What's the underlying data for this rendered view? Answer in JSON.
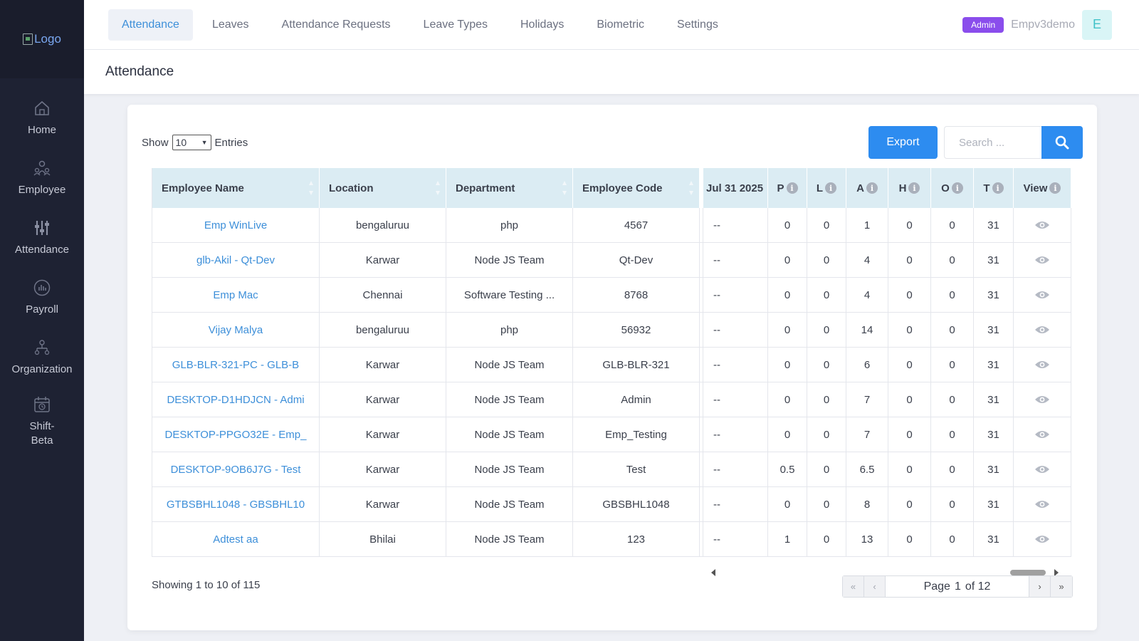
{
  "sidebar": {
    "logo_alt": "Logo",
    "items": [
      {
        "label": "Home",
        "icon": "home-icon"
      },
      {
        "label": "Employee",
        "icon": "employee-icon"
      },
      {
        "label": "Attendance",
        "icon": "attendance-icon"
      },
      {
        "label": "Payroll",
        "icon": "payroll-icon"
      },
      {
        "label": "Organization",
        "icon": "organization-icon"
      },
      {
        "label": "Shift-Beta",
        "icon": "shift-icon"
      }
    ]
  },
  "topbar": {
    "tabs": [
      "Attendance",
      "Leaves",
      "Attendance Requests",
      "Leave Types",
      "Holidays",
      "Biometric",
      "Settings"
    ],
    "active_tab": "Attendance",
    "role_badge": "Admin",
    "username": "Empv3demo",
    "avatar_letter": "E"
  },
  "page": {
    "title": "Attendance"
  },
  "controls": {
    "show_label": "Show",
    "entries_value": "10",
    "entries_label": "Entries",
    "export_label": "Export",
    "search_placeholder": "Search ..."
  },
  "table": {
    "headers": {
      "name": "Employee Name",
      "location": "Location",
      "department": "Department",
      "code": "Employee Code",
      "date": "Jul 31 2025",
      "p": "P",
      "l": "L",
      "a": "A",
      "h": "H",
      "o": "O",
      "t": "T",
      "view": "View"
    },
    "rows": [
      {
        "name": "Emp WinLive",
        "location": "bengaluruu",
        "department": "php",
        "code": "4567",
        "date": "--",
        "p": "0",
        "l": "0",
        "a": "1",
        "h": "0",
        "o": "0",
        "t": "31"
      },
      {
        "name": "glb-Akil - Qt-Dev",
        "location": "Karwar",
        "department": "Node JS Team",
        "code": "Qt-Dev",
        "date": "--",
        "p": "0",
        "l": "0",
        "a": "4",
        "h": "0",
        "o": "0",
        "t": "31"
      },
      {
        "name": "Emp Mac",
        "location": "Chennai",
        "department": "Software Testing ...",
        "code": "8768",
        "date": "--",
        "p": "0",
        "l": "0",
        "a": "4",
        "h": "0",
        "o": "0",
        "t": "31"
      },
      {
        "name": "Vijay Malya",
        "location": "bengaluruu",
        "department": "php",
        "code": "56932",
        "date": "--",
        "p": "0",
        "l": "0",
        "a": "14",
        "h": "0",
        "o": "0",
        "t": "31"
      },
      {
        "name": "GLB-BLR-321-PC - GLB-B",
        "location": "Karwar",
        "department": "Node JS Team",
        "code": "GLB-BLR-321",
        "date": "--",
        "p": "0",
        "l": "0",
        "a": "6",
        "h": "0",
        "o": "0",
        "t": "31"
      },
      {
        "name": "DESKTOP-D1HDJCN - Admi",
        "location": "Karwar",
        "department": "Node JS Team",
        "code": "Admin",
        "date": "--",
        "p": "0",
        "l": "0",
        "a": "7",
        "h": "0",
        "o": "0",
        "t": "31"
      },
      {
        "name": "DESKTOP-PPGO32E - Emp_",
        "location": "Karwar",
        "department": "Node JS Team",
        "code": "Emp_Testing",
        "date": "--",
        "p": "0",
        "l": "0",
        "a": "7",
        "h": "0",
        "o": "0",
        "t": "31"
      },
      {
        "name": "DESKTOP-9OB6J7G - Test",
        "location": "Karwar",
        "department": "Node JS Team",
        "code": "Test",
        "date": "--",
        "p": "0.5",
        "l": "0",
        "a": "6.5",
        "h": "0",
        "o": "0",
        "t": "31"
      },
      {
        "name": "GTBSBHL1048 - GBSBHL10",
        "location": "Karwar",
        "department": "Node JS Team",
        "code": "GBSBHL1048",
        "date": "--",
        "p": "0",
        "l": "0",
        "a": "8",
        "h": "0",
        "o": "0",
        "t": "31"
      },
      {
        "name": "Adtest aa",
        "location": "Bhilai",
        "department": "Node JS Team",
        "code": "123",
        "date": "--",
        "p": "1",
        "l": "0",
        "a": "13",
        "h": "0",
        "o": "0",
        "t": "31"
      }
    ]
  },
  "footer": {
    "showing": "Showing 1 to 10 of 115",
    "page_label": "Page",
    "page_current": "1",
    "page_of": "of 12"
  },
  "colors": {
    "sidebar_bg": "#1e2233",
    "accent": "#2d8cf0",
    "link": "#3d8fd9",
    "header_row_bg": "#dbecf3",
    "badge": "#8a4dec"
  }
}
